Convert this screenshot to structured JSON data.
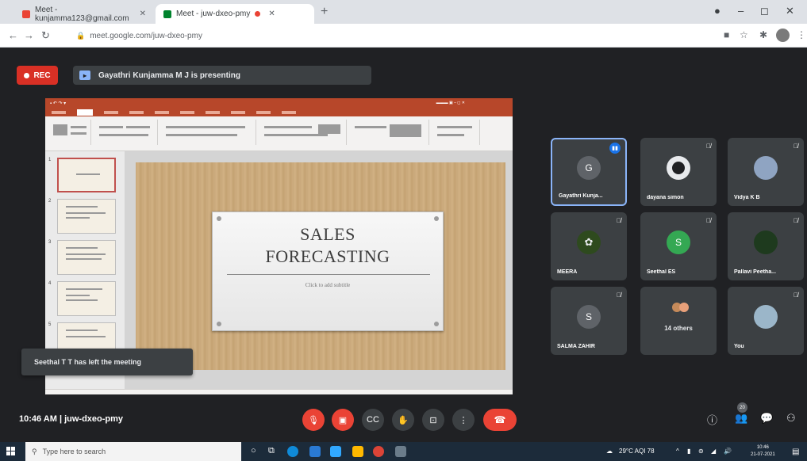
{
  "browser": {
    "tabs": [
      {
        "label": "Meet - kunjamma123@gmail.com"
      },
      {
        "label": "Meet - juw-dxeo-pmy"
      }
    ],
    "url": "meet.google.com/juw-dxeo-pmy"
  },
  "meet": {
    "rec_label": "REC",
    "presenting_text": "Gayathri Kunjamma M J is presenting",
    "toast": "Seethal T T has left the meeting",
    "meeting_info": "10:46 AM  |  juw-dxeo-pmy",
    "participant_count": "20"
  },
  "slide": {
    "title_line1": "SALES",
    "title_line2": "FORECASTING",
    "subtitle": "Click to add subtitle",
    "thumb_numbers": [
      "1",
      "2",
      "3",
      "4",
      "5"
    ]
  },
  "participants": [
    {
      "name": "Gayathri Kunja...",
      "initial": "G",
      "avatar_color": "#5f6368",
      "speaking": true
    },
    {
      "name": "dayana simon",
      "initial": "",
      "avatar_color": "#e8eaed"
    },
    {
      "name": "Vidya K B",
      "initial": "",
      "avatar_color": "#8fa4c2"
    },
    {
      "name": "MEERA",
      "initial": "",
      "avatar_color": "#2e4a1e"
    },
    {
      "name": "Seethal ES",
      "initial": "S",
      "avatar_color": "#34a853"
    },
    {
      "name": "Pallavi Peetha...",
      "initial": "",
      "avatar_color": "#1e3a1e"
    },
    {
      "name": "SALMA ZAHIR",
      "initial": "S",
      "avatar_color": "#5f6368"
    },
    {
      "name": "14 others",
      "initial": "",
      "avatar_color": "#3c4043"
    },
    {
      "name": "You",
      "initial": "",
      "avatar_color": "#9bb6c9"
    }
  ],
  "taskbar": {
    "search_placeholder": "Type here to search",
    "weather": "29°C  AQI 78",
    "time": "10:46",
    "date": "21-07-2021"
  }
}
